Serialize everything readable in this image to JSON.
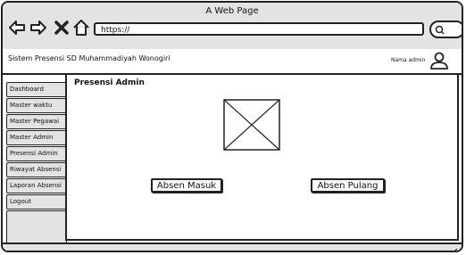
{
  "browser": {
    "window_title": "A Web Page",
    "url": "https://",
    "icons": [
      "back-arrow-icon",
      "forward-arrow-icon",
      "close-icon",
      "home-icon",
      "search-icon"
    ]
  },
  "app": {
    "title": "Sistem Presensi SD Muhammadiyah Wonogiri",
    "admin_name": "Nama admin"
  },
  "sidebar": {
    "items": [
      {
        "label": "Dashboard"
      },
      {
        "label": "Master waktu"
      },
      {
        "label": "Master Pegawai"
      },
      {
        "label": "Master Admin"
      },
      {
        "label": "Presensi Admin"
      },
      {
        "label": "Riwayat Absensi"
      },
      {
        "label": "Laporan Absensi"
      },
      {
        "label": "Logout"
      }
    ]
  },
  "main": {
    "panel_title": "Presensi Admin",
    "buttons": {
      "absen_masuk": "Absen Masuk",
      "absen_pulang": "Absen Pulang"
    }
  },
  "colors": {
    "chrome": "#e3e3e3",
    "stroke": "#222222",
    "background": "#ffffff"
  }
}
